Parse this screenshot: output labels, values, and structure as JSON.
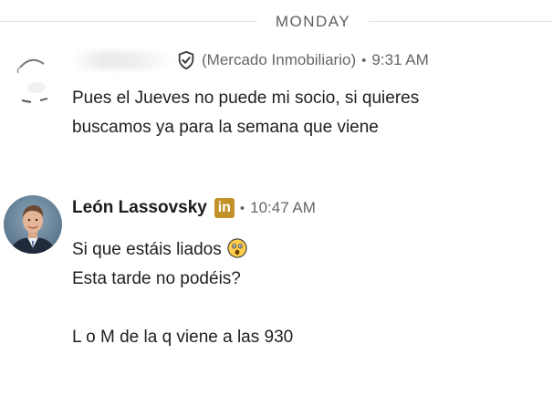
{
  "day_divider": {
    "label": "MONDAY"
  },
  "messages": [
    {
      "sender": {
        "name": "",
        "company": "(Mercado Inmobiliario)",
        "badge_icon": "verified-shield-icon"
      },
      "separator": "•",
      "time": "9:31 AM",
      "lines": [
        "Pues el Jueves no puede mi socio, si quieres",
        "buscamos ya para la semana que viene"
      ]
    },
    {
      "sender": {
        "name": "León Lassovsky",
        "badge_icon": "linkedin-premium-icon",
        "badge_text": "in"
      },
      "separator": "•",
      "time": "10:47 AM",
      "lines": [
        "Si que estáis liados",
        "Esta tarde no podéis?",
        "",
        "L o M de la q viene a las 930"
      ],
      "emoji": "astonished-face-icon"
    }
  ],
  "colors": {
    "badge_gold": "#c3912a",
    "meta_gray": "#666666",
    "divider": "#e2e2e2"
  }
}
